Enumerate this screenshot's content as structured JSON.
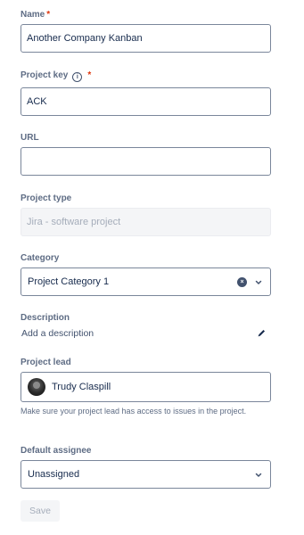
{
  "form": {
    "name": {
      "label": "Name",
      "required_mark": "*",
      "value": "Another Company Kanban"
    },
    "project_key": {
      "label": "Project key",
      "info_glyph": "i",
      "required_mark": "*",
      "value": "ACK"
    },
    "url": {
      "label": "URL",
      "value": ""
    },
    "project_type": {
      "label": "Project type",
      "value": "Jira - software project"
    },
    "category": {
      "label": "Category",
      "value": "Project Category 1",
      "clear_glyph": "×"
    },
    "description": {
      "label": "Description",
      "placeholder": "Add a description"
    },
    "project_lead": {
      "label": "Project lead",
      "value": "Trudy Claspill",
      "help": "Make sure your project lead has access to issues in the project."
    },
    "default_assignee": {
      "label": "Default assignee",
      "value": "Unassigned"
    },
    "save_label": "Save"
  },
  "icons": {
    "info": "info-icon",
    "clear": "clear-icon",
    "chevron": "chevron-down-icon",
    "edit": "pencil-icon",
    "avatar": "avatar"
  },
  "colors": {
    "required": "#de350b",
    "label": "#5e6c84",
    "border": "#7a869a",
    "disabled_bg": "#f4f5f7",
    "text": "#172b4d"
  }
}
